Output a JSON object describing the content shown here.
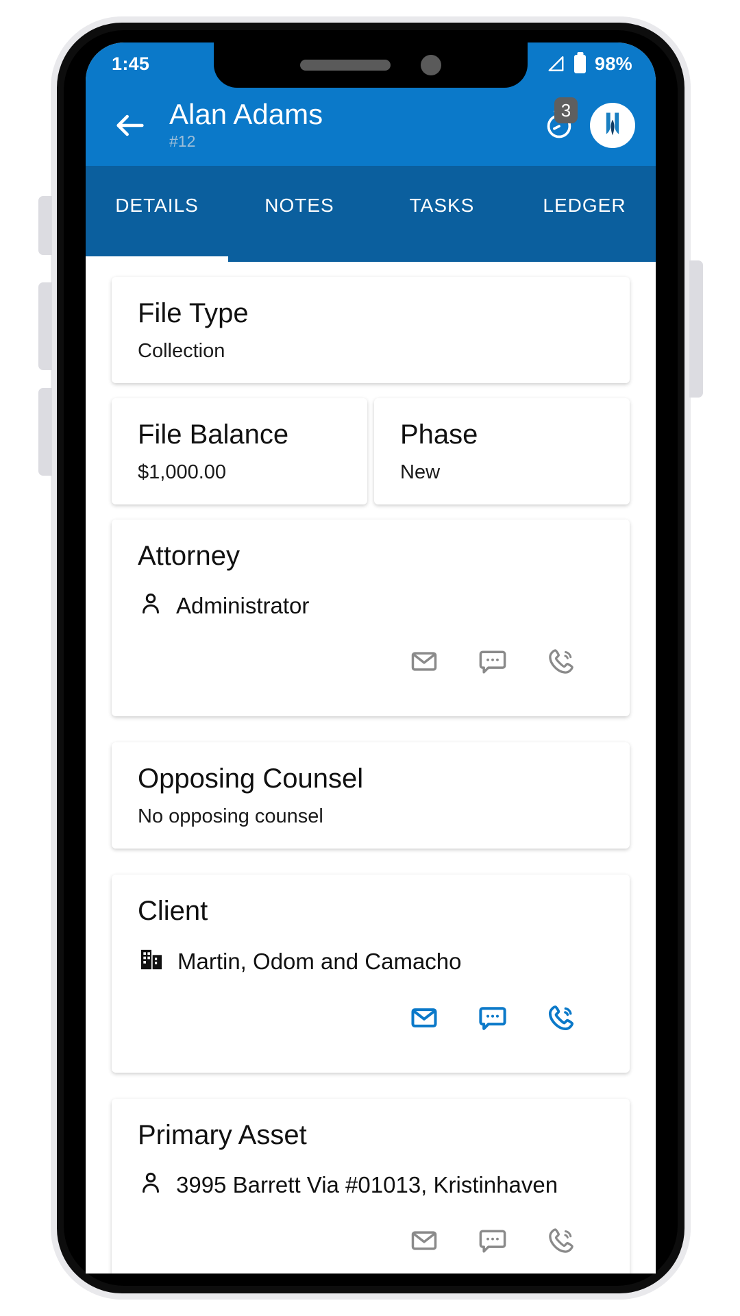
{
  "statusbar": {
    "time": "1:45",
    "signal_icon": "signal-triangle-icon",
    "battery_icon": "battery-icon",
    "battery_pct": "98%"
  },
  "appbar": {
    "back_icon": "back-arrow-icon",
    "title": "Alan Adams",
    "subtitle": "#12",
    "timer_icon": "timer-icon",
    "timer_badge": "3",
    "avatar_icon": "avatar-logo-icon",
    "accent": "#0b79c9"
  },
  "tabs": {
    "items": [
      {
        "label": "DETAILS",
        "active": true
      },
      {
        "label": "NOTES",
        "active": false
      },
      {
        "label": "TASKS",
        "active": false
      },
      {
        "label": "LEDGER",
        "active": false
      }
    ]
  },
  "cards": {
    "file_type": {
      "title": "File Type",
      "value": "Collection"
    },
    "file_balance": {
      "title": "File Balance",
      "value": "$1,000.00"
    },
    "phase": {
      "title": "Phase",
      "value": "New"
    },
    "attorney": {
      "title": "Attorney",
      "name": "Administrator",
      "person_icon": "person-icon",
      "actions": [
        {
          "icon": "email-icon",
          "color": "#8a8a8a"
        },
        {
          "icon": "message-icon",
          "color": "#8a8a8a"
        },
        {
          "icon": "phone-icon",
          "color": "#8a8a8a"
        }
      ]
    },
    "opposing_counsel": {
      "title": "Opposing Counsel",
      "value": "No opposing counsel"
    },
    "client": {
      "title": "Client",
      "name": "Martin, Odom and Camacho",
      "person_icon": "building-icon",
      "actions": [
        {
          "icon": "email-icon",
          "color": "#0b79c9"
        },
        {
          "icon": "message-icon",
          "color": "#0b79c9"
        },
        {
          "icon": "phone-icon",
          "color": "#0b79c9"
        }
      ]
    },
    "primary_asset": {
      "title": "Primary Asset",
      "name": "3995 Barrett Via #01013, Kristinhaven",
      "person_icon": "person-icon",
      "actions": [
        {
          "icon": "email-icon",
          "color": "#8a8a8a"
        },
        {
          "icon": "message-icon",
          "color": "#8a8a8a"
        },
        {
          "icon": "phone-icon",
          "color": "#8a8a8a"
        }
      ]
    }
  }
}
